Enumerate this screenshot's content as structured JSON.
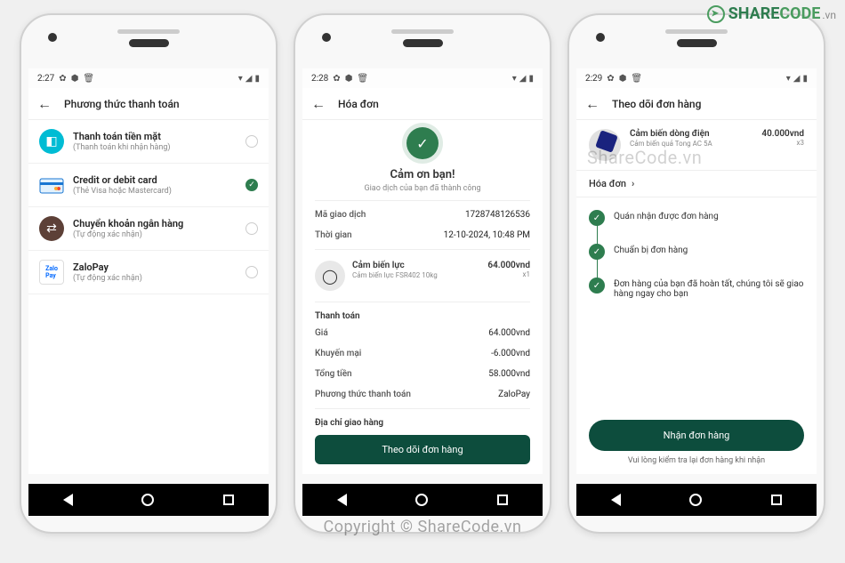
{
  "logo": {
    "text1": "SHARE",
    "text2": "CODE",
    "vn": ".vn"
  },
  "copyright": "Copyright © ShareCode.vn",
  "watermark2": "ShareCode.vn",
  "phone1": {
    "time": "2:27",
    "header": "Phương thức thanh toán",
    "methods": [
      {
        "title": "Thanh toán tiền mặt",
        "sub": "(Thanh toán khi nhận hàng)",
        "checked": false,
        "icon": "cash"
      },
      {
        "title": "Credit or debit card",
        "sub": "(Thẻ Visa hoặc Mastercard)",
        "checked": true,
        "icon": "card"
      },
      {
        "title": "Chuyển khoản ngân hàng",
        "sub": "(Tự động xác nhận)",
        "checked": false,
        "icon": "bank"
      },
      {
        "title": "ZaloPay",
        "sub": "(Tự động xác nhận)",
        "checked": false,
        "icon": "zalo"
      }
    ]
  },
  "phone2": {
    "time": "2:28",
    "header": "Hóa đơn",
    "thank_title": "Cảm ơn bạn!",
    "thank_sub": "Giao dịch của bạn đã thành công",
    "txn_label": "Mã giao dịch",
    "txn_val": "1728748126536",
    "time_label": "Thời gian",
    "time_val": "12-10-2024, 10:48 PM",
    "prod_name": "Cảm biến lực",
    "prod_desc": "Cảm biến lực FSR402 10kg",
    "prod_price": "64.000vnd",
    "prod_qty": "x1",
    "pay_section": "Thanh toán",
    "price_label": "Giá",
    "price_val": "64.000vnd",
    "promo_label": "Khuyến mại",
    "promo_val": "-6.000vnd",
    "total_label": "Tổng tiền",
    "total_val": "58.000vnd",
    "method_label": "Phương thức thanh toán",
    "method_val": "ZaloPay",
    "addr_section": "Địa chỉ giao hàng",
    "track_btn": "Theo dõi đơn hàng"
  },
  "phone3": {
    "time": "2:29",
    "header": "Theo dõi đơn hàng",
    "prod_name": "Cảm biến dòng điện",
    "prod_desc": "Cảm biến quả Tong AC 5A",
    "prod_price": "40.000vnd",
    "prod_qty": "x3",
    "invoice": "Hóa đơn",
    "steps": [
      "Quán nhận được đơn hàng",
      "Chuẩn bị đơn hàng",
      "Đơn hàng của bạn đã hoàn tất, chúng tôi sẽ giao hàng ngay cho bạn"
    ],
    "receive_btn": "Nhận đơn hàng",
    "check_note": "Vui lòng kiểm tra lại đơn hàng khi nhận"
  }
}
